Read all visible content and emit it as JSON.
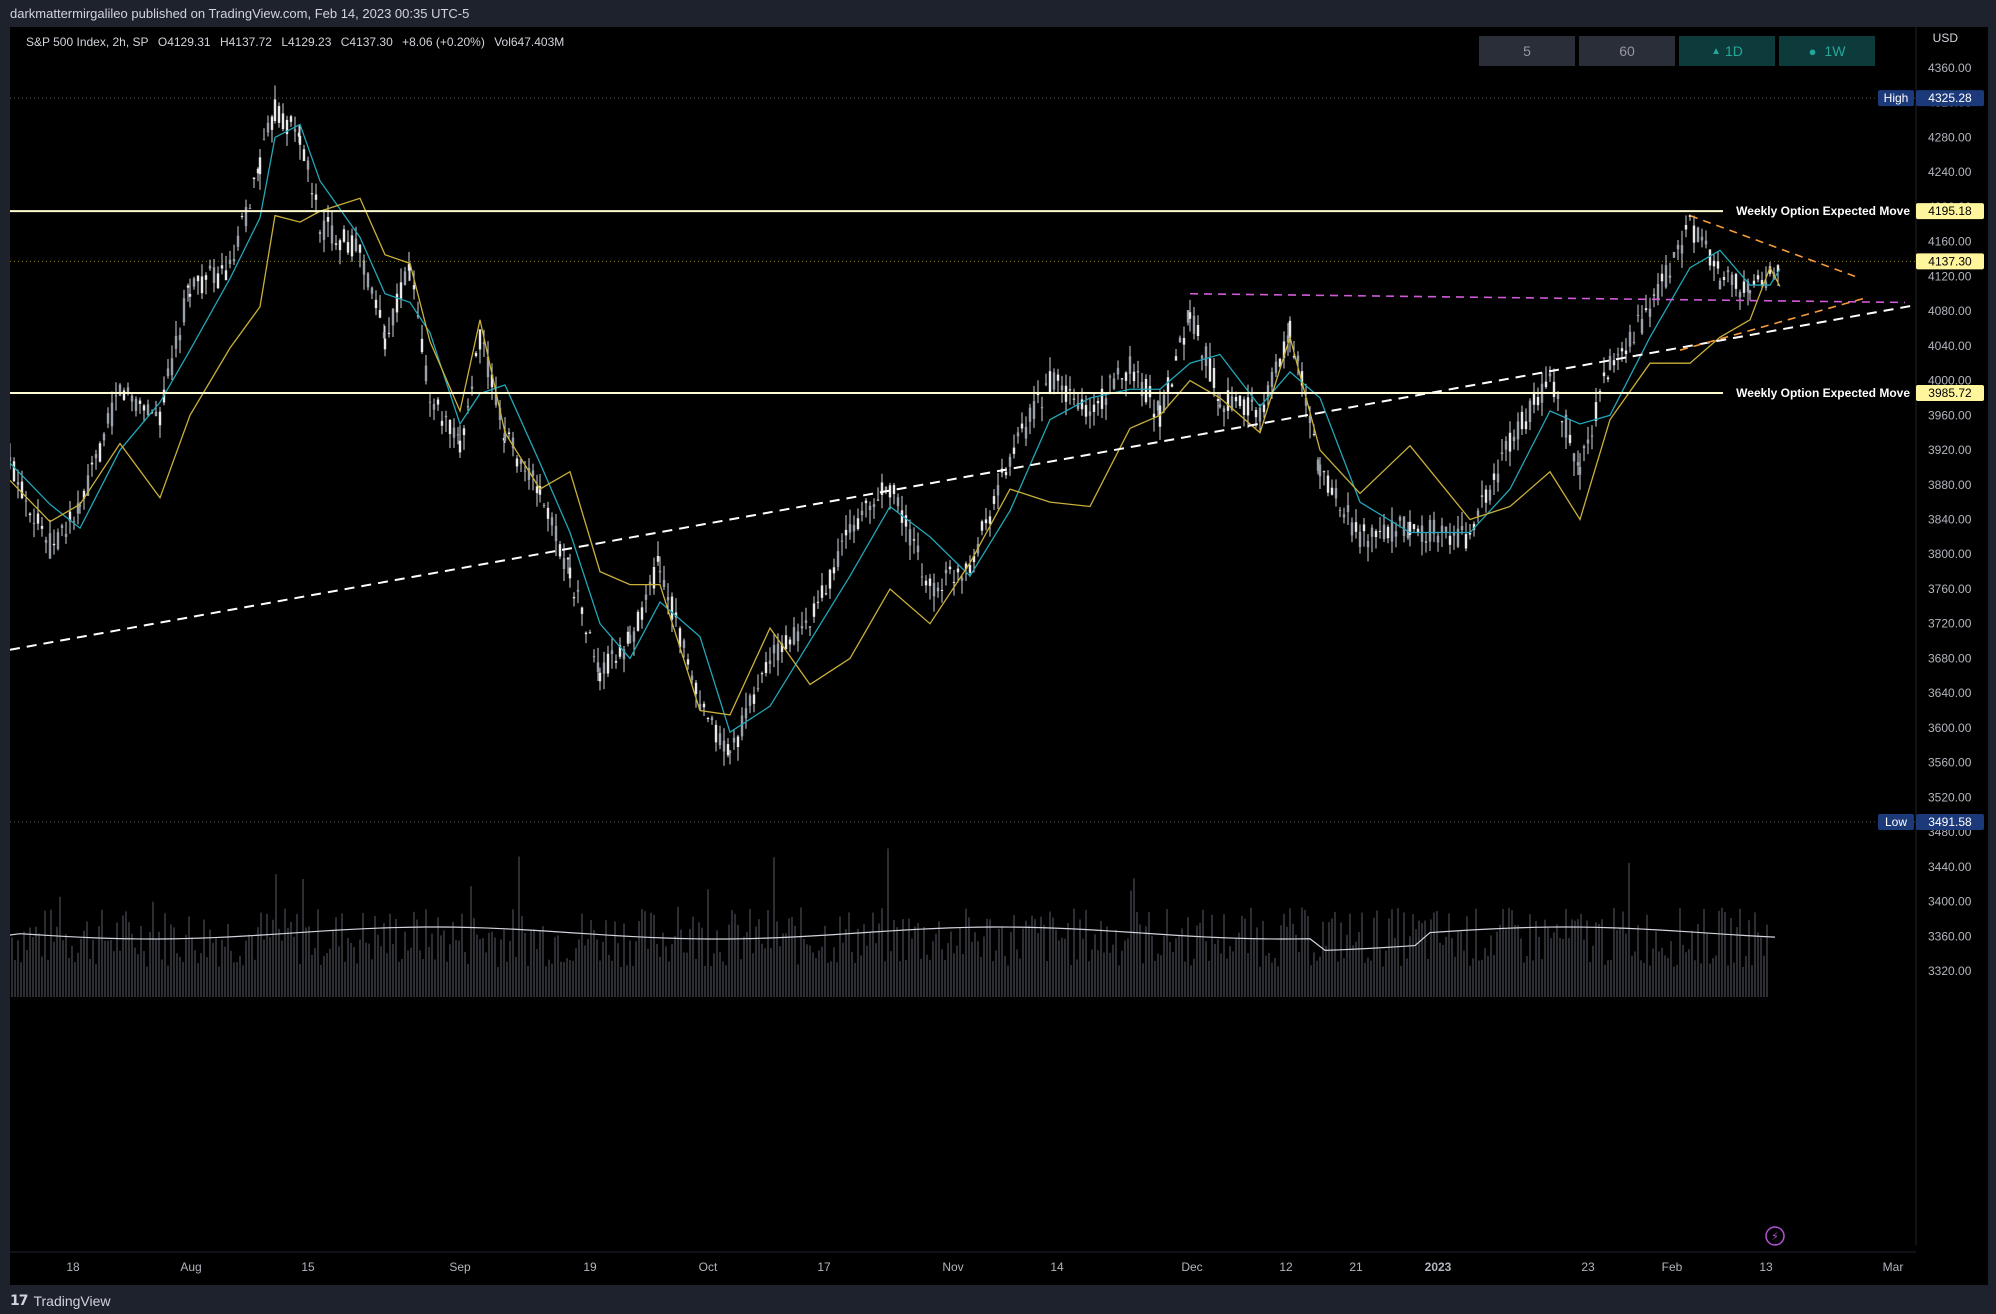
{
  "publish_line": "darkmattermirgalileo published on TradingView.com, Feb 14, 2023 00:35 UTC-5",
  "legend": {
    "symbol": "S&P 500 Index, 2h, SP",
    "open": "O4129.31",
    "high": "H4137.72",
    "low": "L4129.23",
    "close": "C4137.30",
    "change": "+8.06 (+0.20%)",
    "volume": "Vol647.403M"
  },
  "timeframes": [
    {
      "label": "5",
      "active": false
    },
    {
      "label": "60",
      "active": false
    },
    {
      "label": "1D",
      "icon": "triangle-up-icon",
      "active": true
    },
    {
      "label": "1W",
      "icon": "circle-icon",
      "active": true
    }
  ],
  "currency": "USD",
  "price_labels": [
    "4360.00",
    "4320.00",
    "4280.00",
    "4240.00",
    "4200.00",
    "4160.00",
    "4120.00",
    "4080.00",
    "4040.00",
    "4000.00",
    "3960.00",
    "3920.00",
    "3880.00",
    "3840.00",
    "3800.00",
    "3760.00",
    "3720.00",
    "3680.00",
    "3640.00",
    "3600.00",
    "3560.00",
    "3520.00",
    "3480.00",
    "3440.00",
    "3400.00",
    "3360.00",
    "3320.00"
  ],
  "markers": {
    "high_label": "High",
    "high_value": "4325.28",
    "low_label": "Low",
    "low_value": "3491.58",
    "last_price": "4137.30",
    "upper_move_label": "Weekly Option Expected Move",
    "upper_move_value": "4195.18",
    "lower_move_label": "Weekly Option Expected Move",
    "lower_move_value": "3985.72"
  },
  "time_labels": [
    "18",
    "Aug",
    "15",
    "Sep",
    "19",
    "Oct",
    "17",
    "Nov",
    "14",
    "Dec",
    "12",
    "21",
    "2023",
    "23",
    "Feb",
    "13",
    "Mar"
  ],
  "footer": {
    "brand": "TradingView"
  },
  "colors": {
    "background": "#000000",
    "candle": "#d1d4dc",
    "ema_fast": "#22a5b8",
    "ema_slow": "#c9b03a",
    "expected_move_line": "#fffbd0",
    "trend_line": "#ffffff",
    "magenta_line": "#d15bd6",
    "orange_line": "#f39a3b",
    "label_blue": "#1c3a7a",
    "label_yellow": "#fff59d"
  }
}
